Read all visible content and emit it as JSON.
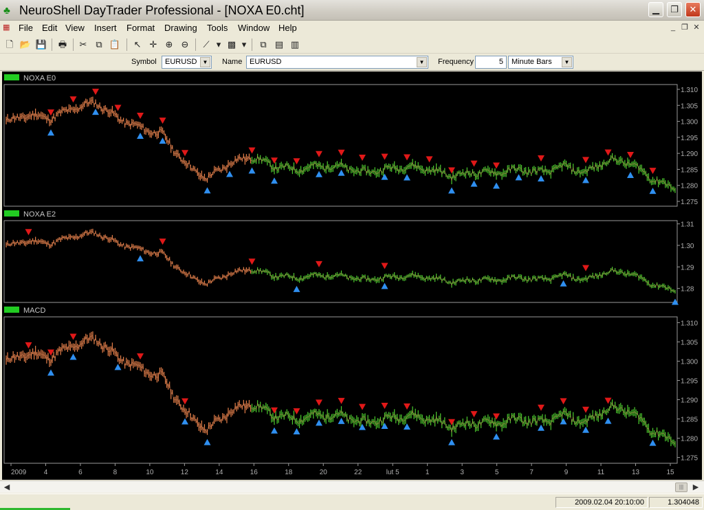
{
  "window": {
    "title": "NeuroShell DayTrader Professional - [NOXA E0.cht]",
    "app_icon": "neuroshell-app-icon",
    "controls": [
      "minimize-icon",
      "restore-icon",
      "close-icon"
    ]
  },
  "menu": {
    "items": [
      "File",
      "Edit",
      "View",
      "Insert",
      "Format",
      "Drawing",
      "Tools",
      "Window",
      "Help"
    ],
    "mdi_controls": [
      "_",
      "❐",
      "✕"
    ]
  },
  "toolbar": {
    "icons": [
      "new-icon",
      "open-icon",
      "save-icon",
      "print-icon",
      "cut-icon",
      "copy-icon",
      "paste-icon",
      "pointer-icon",
      "crosshair-icon",
      "zoom-box-icon",
      "zoom-out-icon",
      "line-tool-icon",
      "fill-pattern-icon",
      "windows-icon",
      "chart-properties-icon",
      "indicators-icon"
    ]
  },
  "symbol_bar": {
    "symbol_label": "Symbol",
    "symbol_value": "EURUSD",
    "name_label": "Name",
    "name_value": "EURUSD",
    "frequency_label": "Frequency",
    "frequency_value": "5",
    "bars_value": "Minute Bars"
  },
  "chart_data": [
    {
      "type": "line",
      "title": "NOXA E0",
      "yticks": [
        "1.310",
        "1.305",
        "1.300",
        "1.295",
        "1.290",
        "1.285",
        "1.280",
        "1.275"
      ],
      "ylim": [
        1.2735,
        1.3115
      ],
      "series_colors": {
        "before_switch": "#e8804a",
        "after_switch": "#4ccc2e",
        "buy": "#2f8ff0",
        "sell": "#e01818"
      },
      "price": [
        1.3,
        1.302,
        1.301,
        1.304,
        1.306,
        1.301,
        1.298,
        1.296,
        1.287,
        1.282,
        1.287,
        1.289,
        1.286,
        1.285,
        1.286,
        1.286,
        1.284,
        1.285,
        1.286,
        1.285,
        1.283,
        1.284,
        1.284,
        1.285,
        1.284,
        1.286,
        1.284,
        1.288,
        1.287,
        1.282,
        1.279
      ],
      "switch_index": 11,
      "buy_index": [
        2,
        4,
        6,
        7,
        9,
        10,
        11,
        12,
        14,
        15,
        17,
        18,
        20,
        21,
        22,
        23,
        24,
        26,
        28,
        29
      ],
      "sell_index": [
        2,
        3,
        4,
        5,
        6,
        7,
        8,
        11,
        12,
        13,
        14,
        15,
        16,
        17,
        18,
        19,
        20,
        21,
        22,
        24,
        26,
        27,
        28,
        29
      ]
    },
    {
      "type": "line",
      "title": "NOXA E2",
      "yticks": [
        "1.31",
        "1.30",
        "1.29",
        "1.28"
      ],
      "ylim": [
        1.2735,
        1.3115
      ],
      "series_colors": {
        "before_switch": "#e8804a",
        "after_switch": "#4ccc2e",
        "buy": "#2f8ff0",
        "sell": "#e01818"
      },
      "price": [
        1.3,
        1.302,
        1.301,
        1.304,
        1.306,
        1.301,
        1.298,
        1.296,
        1.287,
        1.282,
        1.287,
        1.289,
        1.286,
        1.285,
        1.286,
        1.286,
        1.284,
        1.285,
        1.286,
        1.285,
        1.283,
        1.284,
        1.284,
        1.285,
        1.284,
        1.286,
        1.284,
        1.288,
        1.287,
        1.282,
        1.279
      ],
      "switch_index": 11,
      "buy_index": [
        6,
        13,
        17,
        25,
        30
      ],
      "sell_index": [
        1,
        7,
        11,
        14,
        17,
        26
      ]
    },
    {
      "type": "line",
      "title": "MACD",
      "yticks": [
        "1.310",
        "1.305",
        "1.300",
        "1.295",
        "1.290",
        "1.285",
        "1.280",
        "1.275"
      ],
      "ylim": [
        1.2735,
        1.3115
      ],
      "series_colors": {
        "before_switch": "#e8804a",
        "after_switch": "#4ccc2e",
        "buy": "#2f8ff0",
        "sell": "#e01818"
      },
      "price": [
        1.3,
        1.302,
        1.301,
        1.304,
        1.306,
        1.301,
        1.298,
        1.296,
        1.287,
        1.282,
        1.287,
        1.289,
        1.286,
        1.285,
        1.286,
        1.286,
        1.284,
        1.285,
        1.286,
        1.285,
        1.283,
        1.284,
        1.284,
        1.285,
        1.284,
        1.286,
        1.284,
        1.288,
        1.287,
        1.282,
        1.279
      ],
      "switch_index": 11,
      "buy_index": [
        2,
        3,
        5,
        8,
        9,
        12,
        13,
        14,
        15,
        16,
        17,
        18,
        20,
        22,
        24,
        25,
        26,
        27,
        29
      ],
      "sell_index": [
        1,
        2,
        3,
        6,
        8,
        12,
        13,
        14,
        15,
        16,
        17,
        18,
        20,
        21,
        22,
        24,
        25,
        26,
        27
      ]
    }
  ],
  "x_axis": {
    "labels": [
      "2009",
      "4",
      "6",
      "8",
      "10",
      "12",
      "14",
      "16",
      "18",
      "20",
      "22",
      "lut 5",
      "1",
      "3",
      "5",
      "7",
      "9",
      "11",
      "13",
      "15"
    ]
  },
  "status": {
    "datetime": "2009.02.04 20:10:00",
    "value": "1.304048",
    "progress": 0.1
  }
}
